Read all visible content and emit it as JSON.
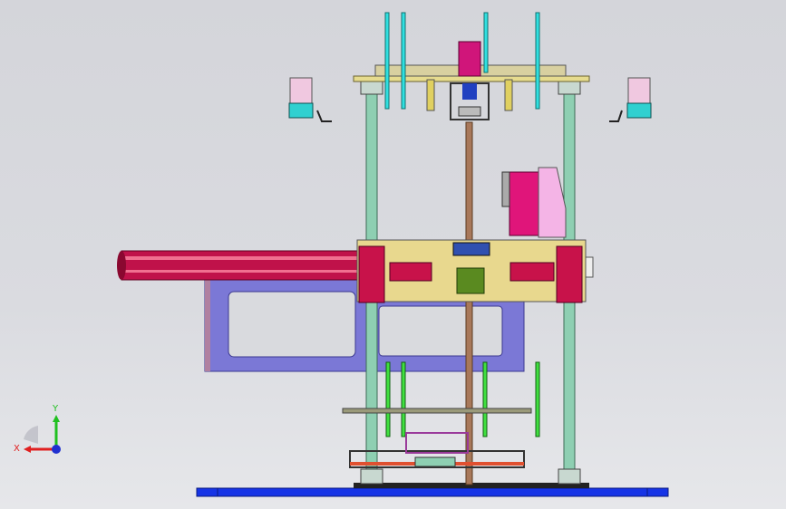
{
  "viewport": {
    "name": "3D CAD viewport",
    "background": "#d9dadf"
  },
  "triad": {
    "x_label": "X",
    "y_label": "Y",
    "x_color": "#e02020",
    "y_color": "#20c020",
    "z_color": "#2030d0"
  },
  "colors": {
    "base_plate": "#1030e0",
    "column": "#8fd0b0",
    "top_plate": "#e8dc90",
    "carriage": "#e8d890",
    "motor": "#e0157a",
    "frame": "#7a74d8",
    "cylinder_rod": "#c01040",
    "leadscrew": "#a07050",
    "pin": "#30e0e0",
    "green_pin": "#40e040"
  }
}
